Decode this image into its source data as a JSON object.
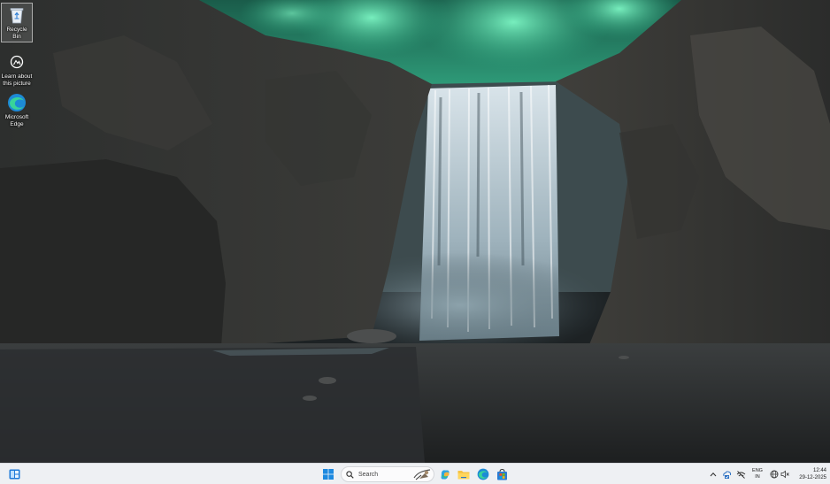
{
  "desktop": {
    "icons": [
      {
        "label": "Recycle Bin",
        "icon": "recycle-bin-icon"
      },
      {
        "label": "Learn about\nthis picture",
        "icon": "learn-about-picture-icon"
      },
      {
        "label": "Microsoft\nEdge",
        "icon": "edge-icon"
      }
    ]
  },
  "taskbar": {
    "widgets_icon": "widgets-icon",
    "start_icon": "windows-start-icon",
    "search": {
      "text": "Search",
      "icon": "search-icon"
    },
    "apps": [
      {
        "name": "copilot",
        "icon": "copilot-icon"
      },
      {
        "name": "file-explorer",
        "icon": "folder-icon"
      },
      {
        "name": "microsoft-edge",
        "icon": "edge-icon"
      },
      {
        "name": "microsoft-store",
        "icon": "store-icon"
      }
    ]
  },
  "tray": {
    "language_line1": "ENG",
    "language_line2": "IN",
    "time": "12:44",
    "date": "29-12-2025",
    "icons": [
      "chevron-up-icon",
      "onedrive-sync-icon",
      "network-off-icon",
      "network-icon",
      "volume-muted-icon"
    ]
  },
  "colors": {
    "taskbar_bg": "#eef0f3",
    "aurora": "#3fd6a0",
    "accent_blue": "#0f6cbd"
  }
}
